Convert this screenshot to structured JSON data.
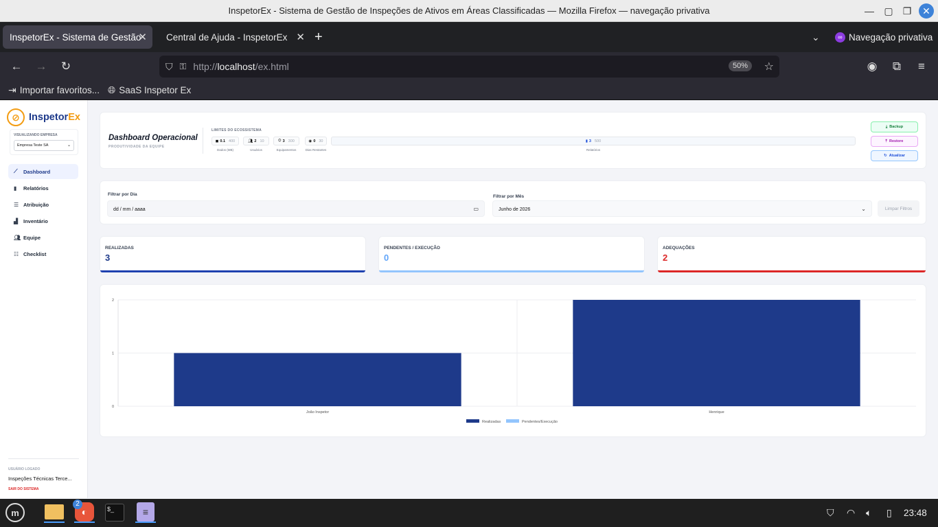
{
  "window": {
    "title": "InspetorEx - Sistema de Gestão de Inspeções de Ativos em Áreas Classificadas — Mozilla Firefox — navegação privativa"
  },
  "tabs": [
    {
      "label": "InspetorEx - Sistema de Gestão",
      "active": true
    },
    {
      "label": "Central de Ajuda - InspetorEx",
      "active": false
    }
  ],
  "browser": {
    "private_label": "Navegação privativa",
    "url_prefix": "http://",
    "url_host": "localhost",
    "url_path": "/ex.html",
    "zoom": "50%"
  },
  "bookmarks": [
    {
      "label": "Importar favoritos..."
    },
    {
      "label": "SaaS Inspetor Ex"
    }
  ],
  "sidebar": {
    "logo_a": "Inspetor",
    "logo_b": "Ex",
    "company_label": "VISUALIZANDO EMPRESA",
    "company_value": "Empresa Teste SA",
    "items": [
      {
        "label": "Dashboard",
        "icon": "chart-line-icon",
        "active": true
      },
      {
        "label": "Relatórios",
        "icon": "file-icon"
      },
      {
        "label": "Atribuição",
        "icon": "list-icon"
      },
      {
        "label": "Inventário",
        "icon": "boxes-icon"
      },
      {
        "label": "Equipe",
        "icon": "users-icon"
      },
      {
        "label": "Checklist",
        "icon": "checklist-icon"
      }
    ],
    "user_label": "USUÁRIO LOGADO",
    "user_name": "Inspeções Técnicas Terce...",
    "logout": "SAIR DO SISTEMA"
  },
  "header": {
    "title": "Dashboard Operacional",
    "subtitle": "PRODUTIVIDADE DA EQUIPE",
    "limits_label": "LIMITES DO ECOSSISTEMA",
    "limits": [
      {
        "value": "0.1",
        "max": "400",
        "caption": "Dados (MB)"
      },
      {
        "value": "2",
        "max": "10",
        "caption": "Usuários"
      },
      {
        "value": "3",
        "max": "300",
        "caption": "Equipamentos"
      },
      {
        "value": "0",
        "max": "30",
        "caption": "Dias Restantes"
      },
      {
        "value": "3",
        "max": "500",
        "caption": "Relatórios"
      }
    ],
    "buttons": {
      "backup": "Backup",
      "restore": "Restore",
      "refresh": "Atualizar"
    }
  },
  "filters": {
    "day_label": "Filtrar por Dia",
    "day_placeholder": "dd / mm / aaaa",
    "month_label": "Filtrar por Mês",
    "month_value": "Junho de 2026",
    "clear": "Limpar Filtros"
  },
  "stats": [
    {
      "label": "REALIZADAS",
      "value": "3",
      "color": "#1e40af"
    },
    {
      "label": "PENDENTES / EXECUÇÃO",
      "value": "0",
      "color": "#60a5fa"
    },
    {
      "label": "ADEQUAÇÕES",
      "value": "2",
      "color": "#dc2626"
    }
  ],
  "chart_data": {
    "type": "bar",
    "categories": [
      "João Inspetor",
      "Henrique"
    ],
    "series": [
      {
        "name": "Realizadas",
        "values": [
          1,
          2
        ],
        "color": "#1e3a8a"
      },
      {
        "name": "Pendentes/Execução",
        "values": [
          0,
          0
        ],
        "color": "#93c5fd"
      }
    ],
    "yticks": [
      "0",
      "1",
      "2"
    ],
    "ylim": [
      0,
      2
    ],
    "legend": "bottom",
    "grid": true
  },
  "taskbar": {
    "clock": "23:48",
    "badge": "2"
  }
}
